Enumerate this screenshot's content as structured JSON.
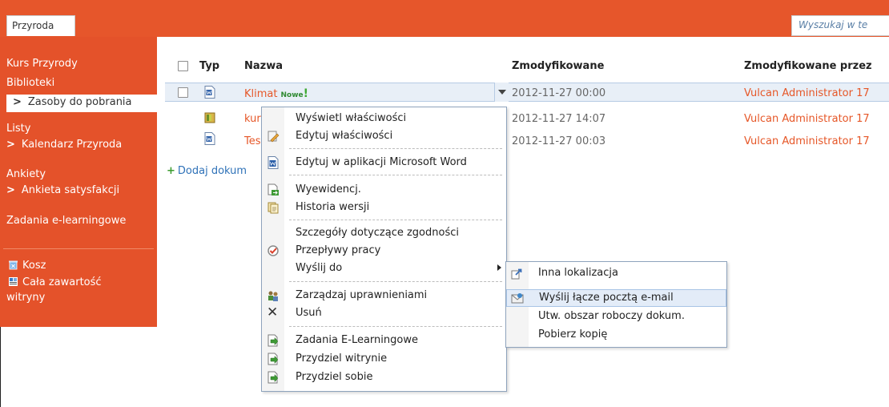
{
  "topbar": {
    "site_tab": "Przyroda",
    "search_placeholder": "Wyszukaj w te"
  },
  "leftnav": {
    "course": "Kurs Przyrody",
    "libraries": "Biblioteki",
    "libraries_selected": "Zasoby do pobrania",
    "lists": "Listy",
    "lists_item": "Kalendarz Przyroda",
    "surveys": "Ankiety",
    "surveys_item": "Ankieta satysfakcji",
    "elearning": "Zadania e-learningowe",
    "recycle_bin": "Kosz",
    "all_content_line1": "Cała zawartość",
    "all_content_line2": "witryny",
    "arrow": ">"
  },
  "list": {
    "headers": {
      "type": "Typ",
      "name": "Nazwa",
      "modified": "Zmodyfikowane",
      "modified_by": "Zmodyfikowane przez"
    },
    "rows": [
      {
        "name": "Klimat",
        "badge": "Nowe",
        "badge_mark": "!",
        "modified": "2012-11-27 00:00",
        "modified_by": "Vulcan Administrator 17"
      },
      {
        "name": "kur",
        "modified": "2012-11-27 14:07",
        "modified_by": "Vulcan Administrator 17"
      },
      {
        "name": "Tes",
        "modified": "2012-11-27 00:03",
        "modified_by": "Vulcan Administrator 17"
      }
    ],
    "add_document": "Dodaj dokum",
    "add_plus": "+"
  },
  "context_menu": {
    "items": [
      "Wyświetl właściwości",
      "Edytuj właściwości",
      "Edytuj w aplikacji Microsoft Word",
      "Wyewidencj.",
      "Historia wersji",
      "Szczegóły dotyczące zgodności",
      "Przepływy pracy",
      "Wyślij do",
      "Zarządzaj uprawnieniami",
      "Usuń",
      "Zadania E-Learningowe",
      "Przydziel witrynie",
      "Przydziel sobie"
    ],
    "delete_glyph": "✕"
  },
  "submenu": {
    "items": [
      "Inna lokalizacja",
      "Wyślij łącze pocztą e-mail",
      "Utw. obszar roboczy dokum.",
      "Pobierz kopię"
    ]
  },
  "colors": {
    "accent": "#e6562b",
    "link": "#e65728",
    "highlight": "#e3ecf8"
  }
}
